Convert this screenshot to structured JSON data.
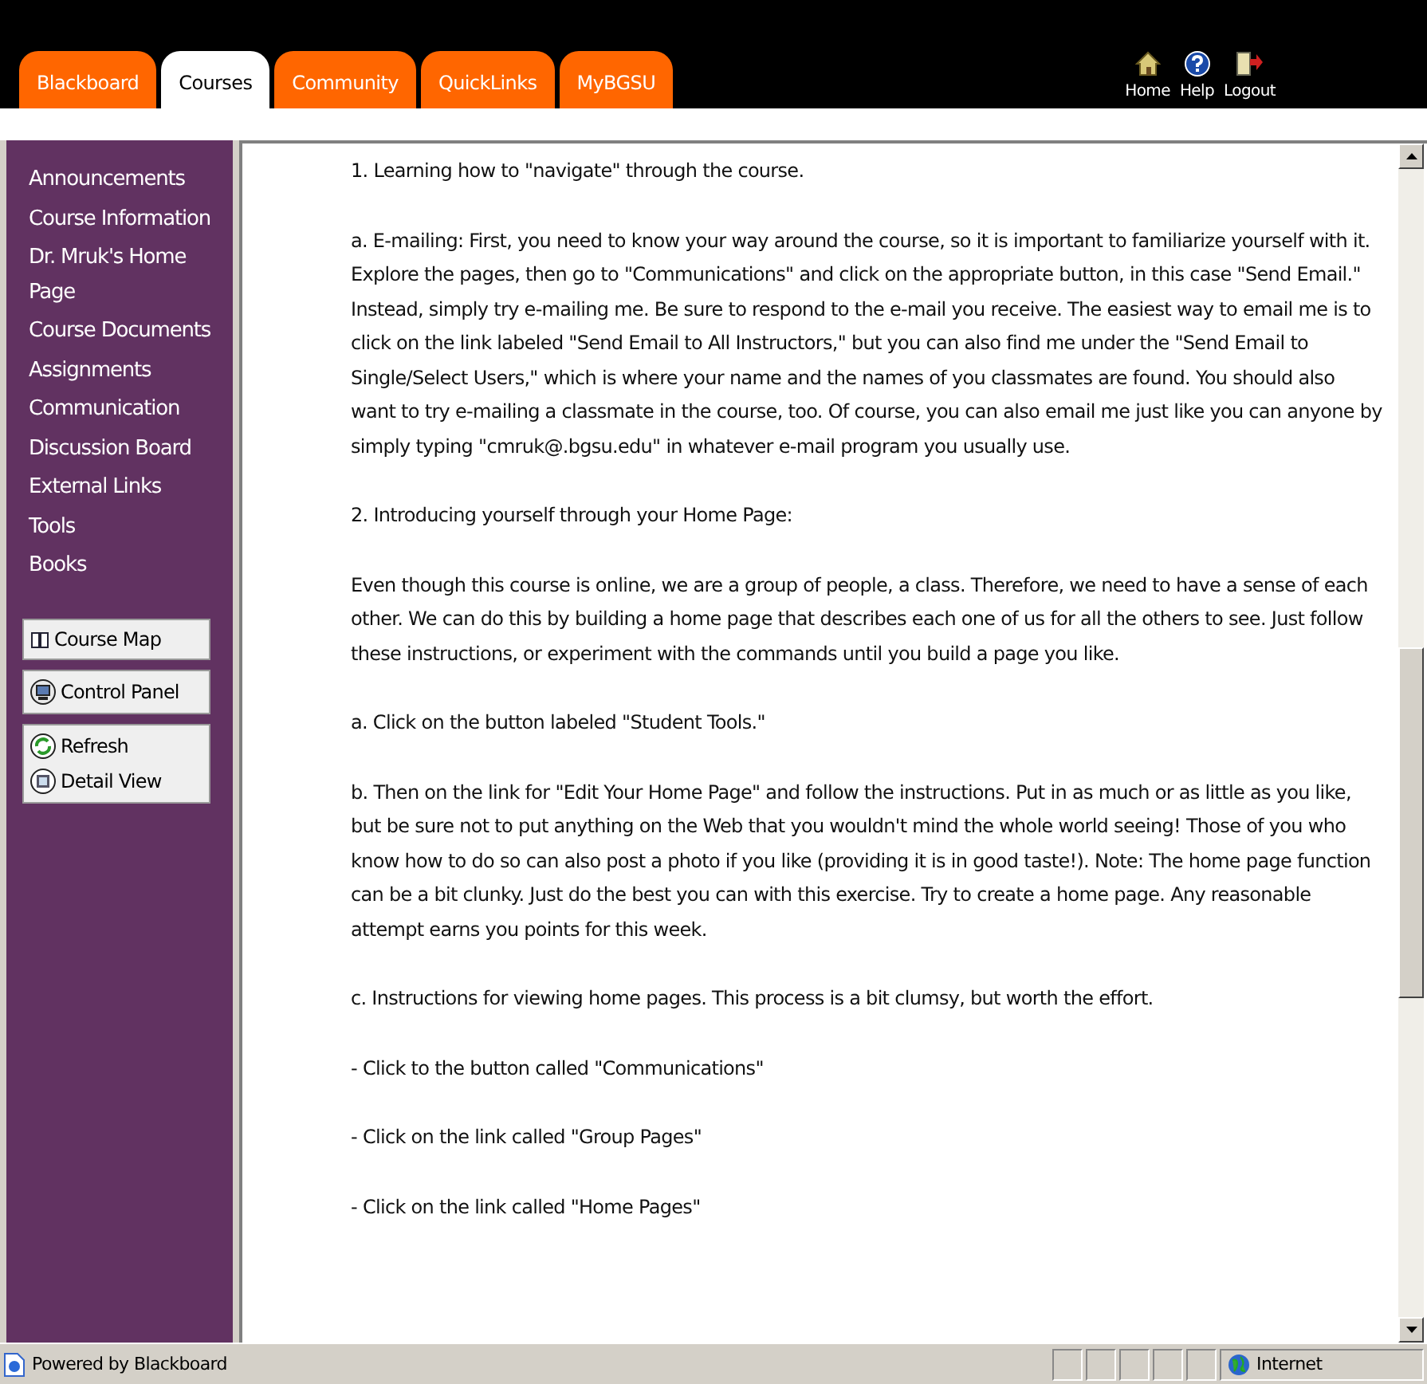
{
  "tabs": [
    {
      "label": "Blackboard",
      "selected": false
    },
    {
      "label": "Courses",
      "selected": true
    },
    {
      "label": "Community",
      "selected": false
    },
    {
      "label": "QuickLinks",
      "selected": false
    },
    {
      "label": "MyBGSU",
      "selected": false
    }
  ],
  "top_links": [
    "Home",
    "Help",
    "Logout"
  ],
  "sidebar": {
    "items": [
      "Announcements",
      "Course Information",
      "Dr. Mruk's Home Page",
      "Course Documents",
      "Assignments",
      "Communication",
      "Discussion Board",
      "External Links",
      "Tools",
      "Books"
    ],
    "button_groups": [
      [
        "Course Map"
      ],
      [
        "Control Panel"
      ],
      [
        "Refresh",
        "Detail View"
      ]
    ]
  },
  "content": {
    "paragraphs": [
      "1. Learning how to \"navigate\" through the course.",
      "a. E-mailing: First, you need to know your way around the course, so it is important to familiarize yourself with it. Explore the pages, then go to \"Communications\" and click on the appropriate button, in this case \"Send Email.\" Instead, simply try e-mailing me. Be sure to respond to the e-mail you receive. The easiest way to email me is to click on the link labeled \"Send Email to All Instructors,\" but you can also find me under the \"Send Email to Single/Select Users,\" which is where your name and the names of you classmates are found. You should also want to try e-mailing a classmate in the course, too. Of course, you can also email me just like you can anyone by simply typing \"cmruk@.bgsu.edu\" in whatever e-mail program you usually use.",
      "2. Introducing yourself through your Home Page:",
      "Even though this course is online, we are a group of people, a class. Therefore, we need to have a sense of each other. We can do this by building a home page that describes each one of us for all the others to see. Just follow these instructions, or experiment with the commands until you build a page you like.",
      "a. Click on the button labeled \"Student Tools.\"",
      "b. Then on the link for \"Edit Your Home Page\" and follow the instructions. Put in as much or as little as you like, but be sure not to put anything on the Web that you wouldn't mind the whole world seeing! Those of you who know how to do so can also post a photo if you like (providing it is in good taste!). Note: The home page function can be a bit clunky. Just do the best you can with this exercise. Try to create a home page. Any reasonable attempt earns you points for this week.",
      "c. Instructions for viewing home pages. This process is a bit clumsy, but worth the effort.",
      "- Click to the button called \"Communications\"",
      "- Click on the link called \"Group Pages\"",
      "- Click on the link called \"Home Pages\""
    ]
  },
  "status_bar": {
    "text": "Powered by Blackboard",
    "zone": "Internet"
  }
}
